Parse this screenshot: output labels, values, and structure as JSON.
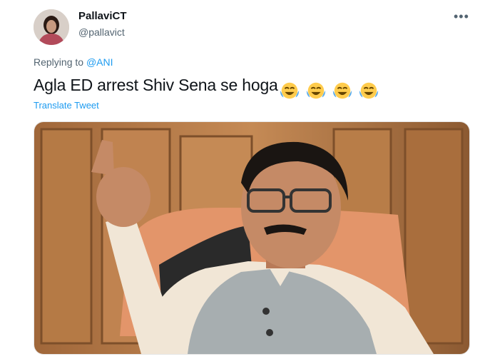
{
  "user": {
    "display_name": "PallaviCT",
    "handle": "@pallavict"
  },
  "reply": {
    "prefix": "Replying to",
    "mention": "@ANI"
  },
  "tweet": {
    "text": "Agla ED arrest Shiv Sena se hoga",
    "emojis": [
      "face-with-tears-of-joy",
      "face-with-tears-of-joy",
      "face-with-tears-of-joy",
      "face-with-tears-of-joy"
    ],
    "translate_label": "Translate Tweet"
  },
  "more_icon": "ellipsis-icon",
  "colors": {
    "link": "#1d9bf0",
    "secondary_text": "#536471"
  }
}
